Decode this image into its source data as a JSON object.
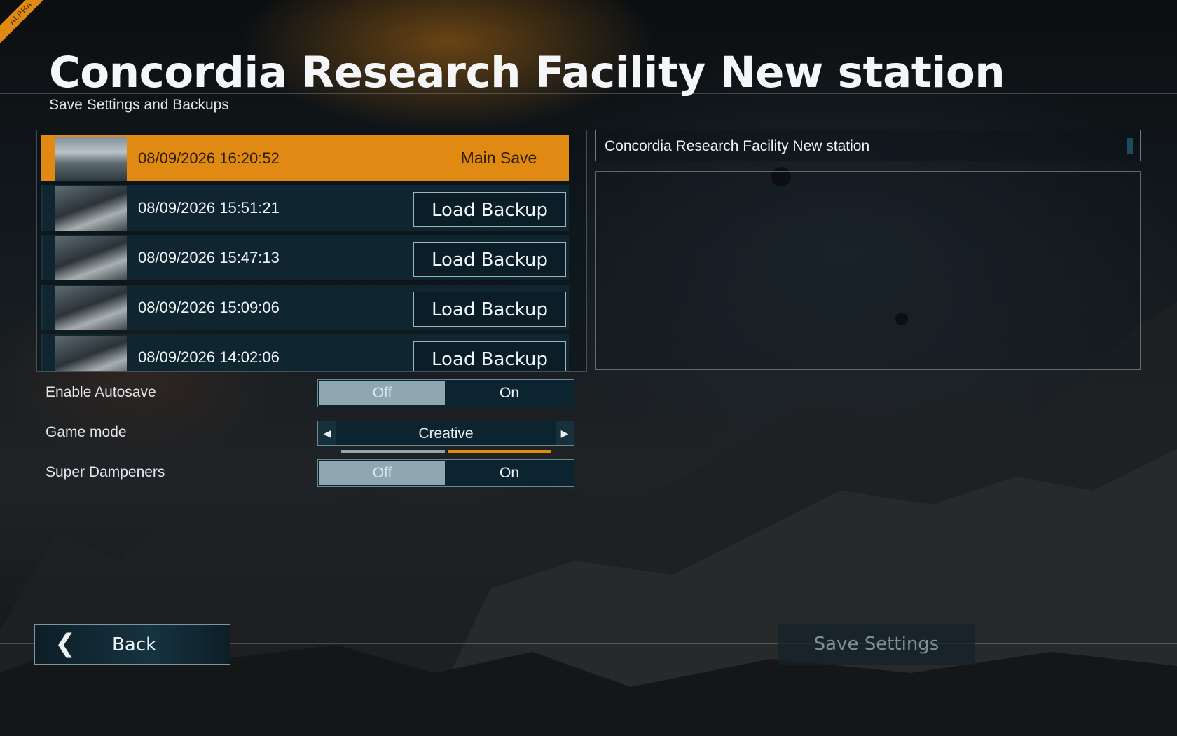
{
  "header": {
    "alpha_badge": "ALPHA",
    "title": "Concordia Research Facility New station",
    "subtitle": "Save Settings and Backups"
  },
  "saves": {
    "main": {
      "date": "08/09/2026 16:20:52",
      "tag": "Main Save"
    },
    "backups": [
      {
        "date": "08/09/2026 15:51:21",
        "action": "Load Backup"
      },
      {
        "date": "08/09/2026 15:47:13",
        "action": "Load Backup"
      },
      {
        "date": "08/09/2026 15:09:06",
        "action": "Load Backup"
      },
      {
        "date": "08/09/2026 14:02:06",
        "action": "Load Backup"
      }
    ]
  },
  "details": {
    "world_name": "Concordia Research Facility New station",
    "description": ""
  },
  "settings": {
    "autosave": {
      "label": "Enable Autosave",
      "off": "Off",
      "on": "On",
      "selected": "Off"
    },
    "game_mode": {
      "label": "Game mode",
      "value": "Creative",
      "left_icon": "caret-left-icon",
      "right_icon": "caret-right-icon"
    },
    "dampeners": {
      "label": "Super Dampeners",
      "off": "Off",
      "on": "On",
      "selected": "Off"
    }
  },
  "footer": {
    "back_label": "Back",
    "back_icon": "chevron-left-icon",
    "save_label": "Save Settings"
  },
  "colors": {
    "accent": "#e08a14",
    "toggle_selected": "#8fa7b1",
    "panel_row": "#0f2631"
  }
}
